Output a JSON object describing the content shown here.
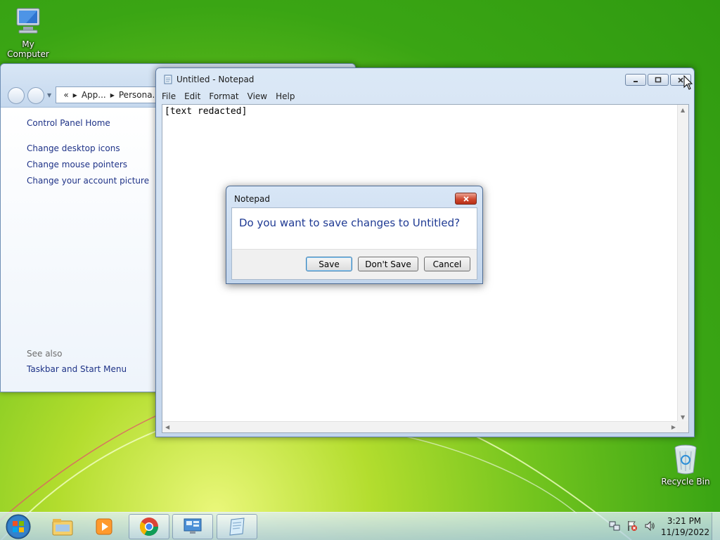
{
  "desktop": {
    "icons": [
      {
        "label": "My Computer",
        "icon": "computer-icon"
      },
      {
        "label": "Recycle Bin",
        "icon": "recycle-bin-icon"
      }
    ]
  },
  "control_panel": {
    "breadcrumb": {
      "overflow": "«",
      "parts": [
        "App...",
        "Persona..."
      ]
    },
    "sidebar": {
      "home": "Control Panel Home",
      "links": [
        "Change desktop icons",
        "Change mouse pointers",
        "Change your account picture"
      ],
      "see_also_label": "See also",
      "see_also_links": [
        "Taskbar and Start Menu"
      ]
    }
  },
  "notepad": {
    "title": "Untitled - Notepad",
    "menu": [
      "File",
      "Edit",
      "Format",
      "View",
      "Help"
    ],
    "content": "[text redacted]"
  },
  "dialog": {
    "title": "Notepad",
    "message": "Do you want to save changes to Untitled?",
    "buttons": {
      "save": "Save",
      "dont_save": "Don't Save",
      "cancel": "Cancel"
    }
  },
  "taskbar": {
    "pinned": [
      "windows-explorer-icon",
      "media-player-icon",
      "chrome-icon",
      "control-panel-icon",
      "notepad-icon"
    ],
    "clock": {
      "time": "3:21 PM",
      "date": "11/19/2022"
    },
    "tray": [
      "network-icon",
      "action-center-flag-icon",
      "volume-icon"
    ]
  },
  "colors": {
    "accent": "#1f3a93",
    "link": "#1e3287",
    "desktop_green": "#4caf1a"
  }
}
